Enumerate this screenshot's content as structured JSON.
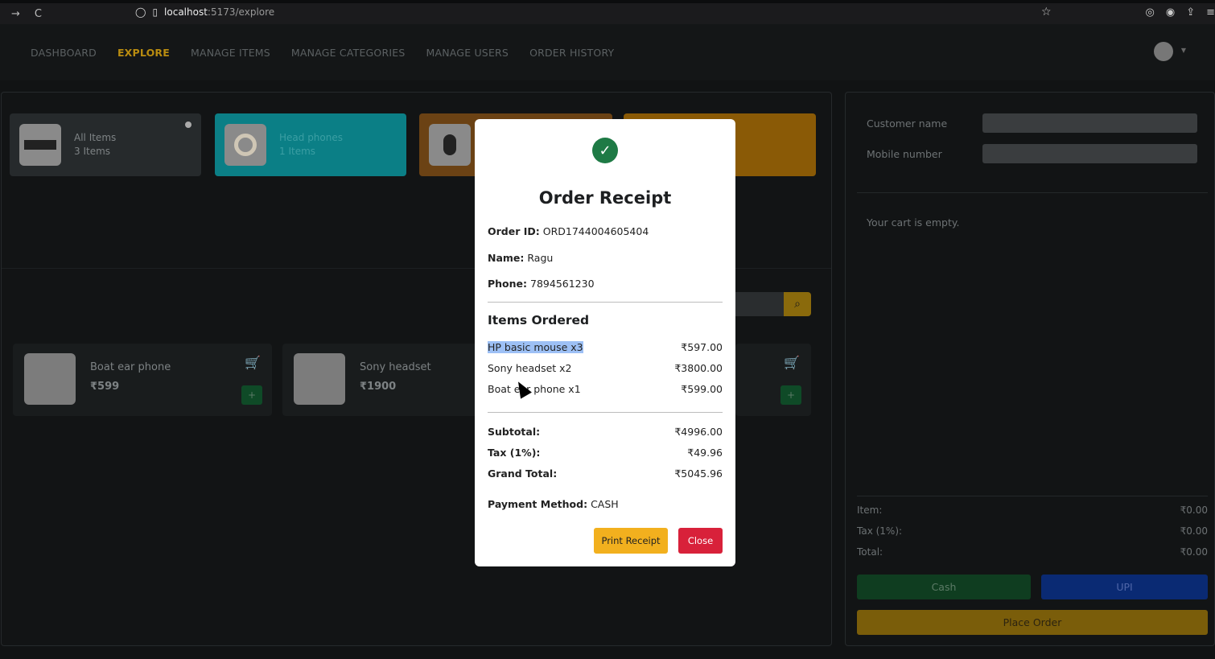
{
  "browser": {
    "back": "→",
    "reload": "C",
    "url_host": "localhost",
    "url_path": ":5173/explore"
  },
  "nav": {
    "items": [
      "DASHBOARD",
      "EXPLORE",
      "MANAGE ITEMS",
      "MANAGE CATEGORIES",
      "MANAGE USERS",
      "ORDER HISTORY"
    ],
    "active": "EXPLORE"
  },
  "categories": [
    {
      "name": "All Items",
      "count": "3 Items"
    },
    {
      "name": "Head phones",
      "count": "1 Items"
    }
  ],
  "items": [
    {
      "name": "Boat ear phone",
      "price": "₹599"
    },
    {
      "name": "Sony headset",
      "price": "₹1900"
    }
  ],
  "customer": {
    "name_label": "Customer name",
    "mobile_label": "Mobile number",
    "cart_empty": "Your cart is empty."
  },
  "summary": {
    "item_label": "Item:",
    "item_value": "₹0.00",
    "tax_label": "Tax (1%):",
    "tax_value": "₹0.00",
    "total_label": "Total:",
    "total_value": "₹0.00"
  },
  "buttons": {
    "cash": "Cash",
    "upi": "UPI",
    "place_order": "Place Order",
    "plus": "+"
  },
  "receipt": {
    "title": "Order Receipt",
    "order_id_label": "Order ID:",
    "order_id": "ORD1744004605404",
    "name_label": "Name:",
    "name": "Ragu",
    "phone_label": "Phone:",
    "phone": "7894561230",
    "items_title": "Items Ordered",
    "lines": [
      {
        "label": "HP basic mouse x3",
        "amount": "₹597.00"
      },
      {
        "label": "Sony headset x2",
        "amount": "₹3800.00"
      },
      {
        "label": "Boat ear phone x1",
        "amount": "₹599.00"
      }
    ],
    "subtotal_label": "Subtotal:",
    "subtotal": "₹4996.00",
    "tax_label": "Tax (1%):",
    "tax": "₹49.96",
    "grand_label": "Grand Total:",
    "grand": "₹5045.96",
    "payment_label": "Payment Method:",
    "payment": "CASH",
    "print_label": "Print Receipt",
    "close_label": "Close"
  },
  "colors": {
    "accent": "#b98c10",
    "success": "#1e7a45",
    "danger": "#d8213a",
    "warning": "#f2b01e"
  }
}
